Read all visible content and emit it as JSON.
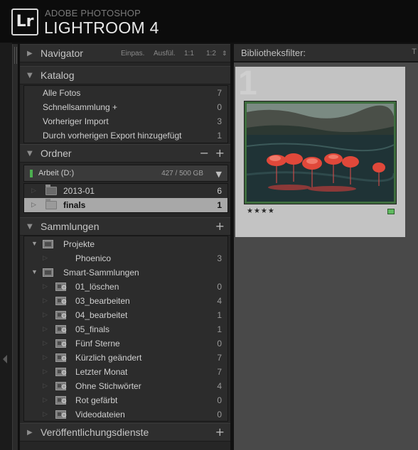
{
  "app": {
    "brand_top": "ADOBE PHOTOSHOP",
    "brand_main": "LIGHTROOM 4",
    "logo": "Lr"
  },
  "navigator": {
    "title": "Navigator",
    "options": [
      "Einpas.",
      "Ausfül.",
      "1:1",
      "1:2"
    ]
  },
  "catalog": {
    "title": "Katalog",
    "items": [
      {
        "label": "Alle Fotos",
        "count": "7"
      },
      {
        "label": "Schnellsammlung  +",
        "count": "0"
      },
      {
        "label": "Vorheriger Import",
        "count": "3"
      },
      {
        "label": "Durch vorherigen Export hinzugefügt",
        "count": "1"
      }
    ]
  },
  "folders": {
    "title": "Ordner",
    "drive": {
      "name": "Arbeit (D:)",
      "size": "427 / 500 GB"
    },
    "items": [
      {
        "label": "2013-01",
        "count": "6",
        "selected": false
      },
      {
        "label": "finals",
        "count": "1",
        "selected": true
      }
    ]
  },
  "collections": {
    "title": "Sammlungen",
    "items": [
      {
        "label": "Projekte",
        "count": "",
        "type": "set"
      },
      {
        "label": "Phoenico",
        "count": "3",
        "type": "collection"
      },
      {
        "label": "Smart-Sammlungen",
        "count": "",
        "type": "set"
      },
      {
        "label": "01_löschen",
        "count": "0",
        "type": "smart"
      },
      {
        "label": "03_bearbeiten",
        "count": "4",
        "type": "smart"
      },
      {
        "label": "04_bearbeitet",
        "count": "1",
        "type": "smart"
      },
      {
        "label": "05_finals",
        "count": "1",
        "type": "smart"
      },
      {
        "label": "Fünf Sterne",
        "count": "0",
        "type": "smart"
      },
      {
        "label": "Kürzlich geändert",
        "count": "7",
        "type": "smart"
      },
      {
        "label": "Letzter Monat",
        "count": "7",
        "type": "smart"
      },
      {
        "label": "Ohne Stichwörter",
        "count": "4",
        "type": "smart"
      },
      {
        "label": "Rot gefärbt",
        "count": "0",
        "type": "smart"
      },
      {
        "label": "Videodateien",
        "count": "0",
        "type": "smart"
      }
    ]
  },
  "publish": {
    "title": "Veröffentlichungsdienste"
  },
  "library_filter": {
    "title": "Bibliotheksfilter:",
    "separator": "T"
  },
  "grid": {
    "cell_number": "1",
    "rating": "★★★★",
    "rating_stars": 4,
    "label_color": "#5fba5f",
    "thumbnail_subject": "flamingos"
  }
}
